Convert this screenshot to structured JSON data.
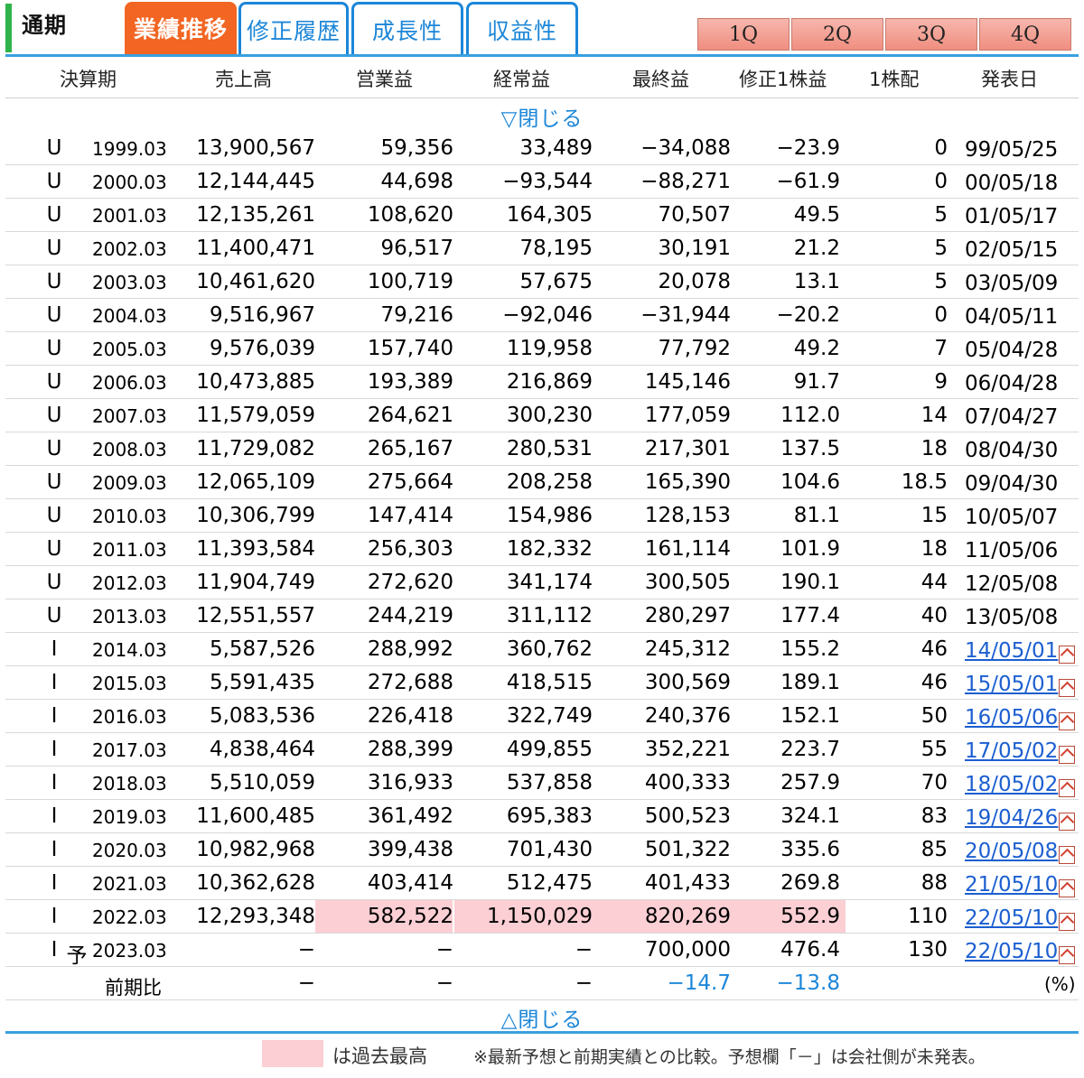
{
  "tabs": {
    "period_label": "通期",
    "active": "業績推移",
    "others": [
      "修正履歴",
      "成長性",
      "収益性"
    ]
  },
  "quarters": [
    "1Q",
    "2Q",
    "3Q",
    "4Q"
  ],
  "columns": [
    "決算期",
    "売上高",
    "営業益",
    "経常益",
    "最終益",
    "修正1株益",
    "1株配",
    "発表日"
  ],
  "toggle_top": "▽閉じる",
  "toggle_bottom": "△閉じる",
  "rows": [
    {
      "std": "U",
      "yo": "",
      "period": "1999.03",
      "sales": "13,900,567",
      "op": "59,356",
      "ord": "33,489",
      "net": "−34,088",
      "eps": "−23.9",
      "div": "0",
      "date": "99/05/25",
      "link": false
    },
    {
      "std": "U",
      "yo": "",
      "period": "2000.03",
      "sales": "12,144,445",
      "op": "44,698",
      "ord": "−93,544",
      "net": "−88,271",
      "eps": "−61.9",
      "div": "0",
      "date": "00/05/18",
      "link": false
    },
    {
      "std": "U",
      "yo": "",
      "period": "2001.03",
      "sales": "12,135,261",
      "op": "108,620",
      "ord": "164,305",
      "net": "70,507",
      "eps": "49.5",
      "div": "5",
      "date": "01/05/17",
      "link": false
    },
    {
      "std": "U",
      "yo": "",
      "period": "2002.03",
      "sales": "11,400,471",
      "op": "96,517",
      "ord": "78,195",
      "net": "30,191",
      "eps": "21.2",
      "div": "5",
      "date": "02/05/15",
      "link": false
    },
    {
      "std": "U",
      "yo": "",
      "period": "2003.03",
      "sales": "10,461,620",
      "op": "100,719",
      "ord": "57,675",
      "net": "20,078",
      "eps": "13.1",
      "div": "5",
      "date": "03/05/09",
      "link": false
    },
    {
      "std": "U",
      "yo": "",
      "period": "2004.03",
      "sales": "9,516,967",
      "op": "79,216",
      "ord": "−92,046",
      "net": "−31,944",
      "eps": "−20.2",
      "div": "0",
      "date": "04/05/11",
      "link": false
    },
    {
      "std": "U",
      "yo": "",
      "period": "2005.03",
      "sales": "9,576,039",
      "op": "157,740",
      "ord": "119,958",
      "net": "77,792",
      "eps": "49.2",
      "div": "7",
      "date": "05/04/28",
      "link": false
    },
    {
      "std": "U",
      "yo": "",
      "period": "2006.03",
      "sales": "10,473,885",
      "op": "193,389",
      "ord": "216,869",
      "net": "145,146",
      "eps": "91.7",
      "div": "9",
      "date": "06/04/28",
      "link": false
    },
    {
      "std": "U",
      "yo": "",
      "period": "2007.03",
      "sales": "11,579,059",
      "op": "264,621",
      "ord": "300,230",
      "net": "177,059",
      "eps": "112.0",
      "div": "14",
      "date": "07/04/27",
      "link": false
    },
    {
      "std": "U",
      "yo": "",
      "period": "2008.03",
      "sales": "11,729,082",
      "op": "265,167",
      "ord": "280,531",
      "net": "217,301",
      "eps": "137.5",
      "div": "18",
      "date": "08/04/30",
      "link": false
    },
    {
      "std": "U",
      "yo": "",
      "period": "2009.03",
      "sales": "12,065,109",
      "op": "275,664",
      "ord": "208,258",
      "net": "165,390",
      "eps": "104.6",
      "div": "18.5",
      "date": "09/04/30",
      "link": false
    },
    {
      "std": "U",
      "yo": "",
      "period": "2010.03",
      "sales": "10,306,799",
      "op": "147,414",
      "ord": "154,986",
      "net": "128,153",
      "eps": "81.1",
      "div": "15",
      "date": "10/05/07",
      "link": false
    },
    {
      "std": "U",
      "yo": "",
      "period": "2011.03",
      "sales": "11,393,584",
      "op": "256,303",
      "ord": "182,332",
      "net": "161,114",
      "eps": "101.9",
      "div": "18",
      "date": "11/05/06",
      "link": false
    },
    {
      "std": "U",
      "yo": "",
      "period": "2012.03",
      "sales": "11,904,749",
      "op": "272,620",
      "ord": "341,174",
      "net": "300,505",
      "eps": "190.1",
      "div": "44",
      "date": "12/05/08",
      "link": false
    },
    {
      "std": "U",
      "yo": "",
      "period": "2013.03",
      "sales": "12,551,557",
      "op": "244,219",
      "ord": "311,112",
      "net": "280,297",
      "eps": "177.4",
      "div": "40",
      "date": "13/05/08",
      "link": false
    },
    {
      "std": "I",
      "yo": "",
      "period": "2014.03",
      "sales": "5,587,526",
      "op": "288,992",
      "ord": "360,762",
      "net": "245,312",
      "eps": "155.2",
      "div": "46",
      "date": "14/05/01",
      "link": true
    },
    {
      "std": "I",
      "yo": "",
      "period": "2015.03",
      "sales": "5,591,435",
      "op": "272,688",
      "ord": "418,515",
      "net": "300,569",
      "eps": "189.1",
      "div": "46",
      "date": "15/05/01",
      "link": true
    },
    {
      "std": "I",
      "yo": "",
      "period": "2016.03",
      "sales": "5,083,536",
      "op": "226,418",
      "ord": "322,749",
      "net": "240,376",
      "eps": "152.1",
      "div": "50",
      "date": "16/05/06",
      "link": true
    },
    {
      "std": "I",
      "yo": "",
      "period": "2017.03",
      "sales": "4,838,464",
      "op": "288,399",
      "ord": "499,855",
      "net": "352,221",
      "eps": "223.7",
      "div": "55",
      "date": "17/05/02",
      "link": true
    },
    {
      "std": "I",
      "yo": "",
      "period": "2018.03",
      "sales": "5,510,059",
      "op": "316,933",
      "ord": "537,858",
      "net": "400,333",
      "eps": "257.9",
      "div": "70",
      "date": "18/05/02",
      "link": true
    },
    {
      "std": "I",
      "yo": "",
      "period": "2019.03",
      "sales": "11,600,485",
      "op": "361,492",
      "ord": "695,383",
      "net": "500,523",
      "eps": "324.1",
      "div": "83",
      "date": "19/04/26",
      "link": true
    },
    {
      "std": "I",
      "yo": "",
      "period": "2020.03",
      "sales": "10,982,968",
      "op": "399,438",
      "ord": "701,430",
      "net": "501,322",
      "eps": "335.6",
      "div": "85",
      "date": "20/05/08",
      "link": true
    },
    {
      "std": "I",
      "yo": "",
      "period": "2021.03",
      "sales": "10,362,628",
      "op": "403,414",
      "ord": "512,475",
      "net": "401,433",
      "eps": "269.8",
      "div": "88",
      "date": "21/05/10",
      "link": true
    },
    {
      "std": "I",
      "yo": "",
      "period": "2022.03",
      "sales": "12,293,348",
      "op": "582,522",
      "ord": "1,150,029",
      "net": "820,269",
      "eps": "552.9",
      "div": "110",
      "date": "22/05/10",
      "link": true,
      "highlight": [
        "op",
        "ord",
        "net",
        "eps"
      ]
    },
    {
      "std": "I",
      "yo": "予",
      "period": "2023.03",
      "sales": "−",
      "op": "−",
      "ord": "−",
      "net": "700,000",
      "eps": "476.4",
      "div": "130",
      "date": "22/05/10",
      "link": true
    }
  ],
  "comparison": {
    "label": "前期比",
    "sales": "−",
    "op": "−",
    "ord": "−",
    "net": "−14.7",
    "eps": "−13.8",
    "unit": "(%)"
  },
  "legend": {
    "highlight_color": "#fbcfd4",
    "text": "は過去最高",
    "note": "※最新予想と前期実績との比較。予想欄「－」は会社側が未発表。"
  },
  "colors": {
    "active_tab": "#f26522",
    "tab_border": "#1c86d8",
    "link": "#1c5fd0",
    "green_marker": "#2fb34a",
    "quarter_button": "#f08e80"
  }
}
